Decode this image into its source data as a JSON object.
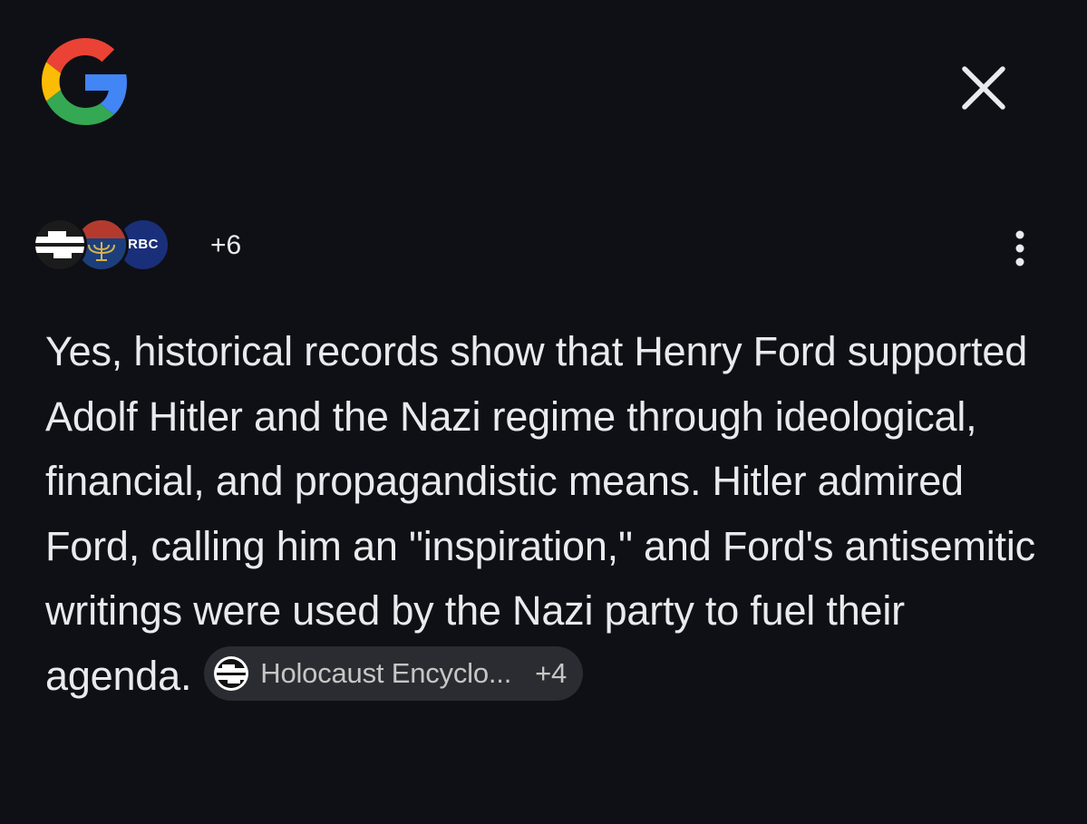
{
  "header": {
    "logo_icon": "google-g-logo",
    "close_icon": "close-icon"
  },
  "sources": {
    "icons": [
      "holocaust-encyclopedia-icon",
      "menorah-crest-icon",
      "nbc-icon"
    ],
    "icon3_label": "RBC",
    "more_count": "+6",
    "menu_icon": "more-vert-icon"
  },
  "answer": {
    "text": "Yes, historical records show that Henry Ford supported Adolf Hitler and the Nazi regime through ideological, financial, and propagandistic means. Hitler admired Ford, calling him an \"inspiration,\" and Ford's antisemitic writings were used by the Nazi party to fuel their agenda.",
    "citation": {
      "label": "Holocaust Encyclo...",
      "more": "+4"
    }
  },
  "colors": {
    "background": "#0f1015",
    "text": "#e8eaed",
    "chip_background": "#2b2c31",
    "google_blue": "#4285F4",
    "google_red": "#EA4335",
    "google_yellow": "#FBBC05",
    "google_green": "#34A853"
  }
}
